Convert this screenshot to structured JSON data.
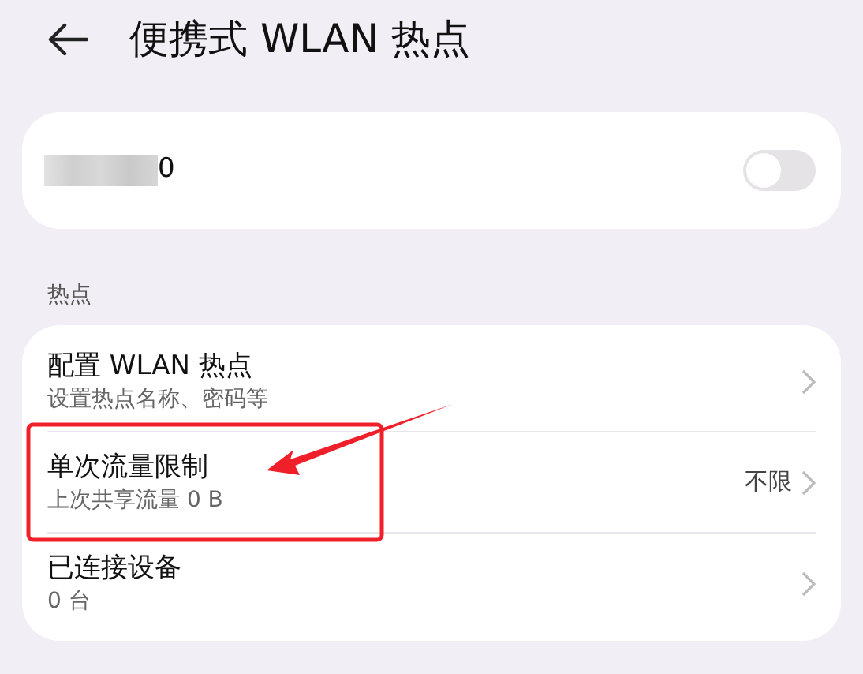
{
  "header": {
    "title": "便携式 WLAN 热点"
  },
  "hotspot": {
    "name": "0",
    "on": false
  },
  "section": {
    "label": "热点"
  },
  "rows": [
    {
      "title": "配置 WLAN 热点",
      "subtitle": "设置热点名称、密码等"
    },
    {
      "title": "单次流量限制",
      "subtitle": "上次共享流量 0 B",
      "value": "不限"
    },
    {
      "title": "已连接设备",
      "subtitle": "0 台"
    }
  ]
}
